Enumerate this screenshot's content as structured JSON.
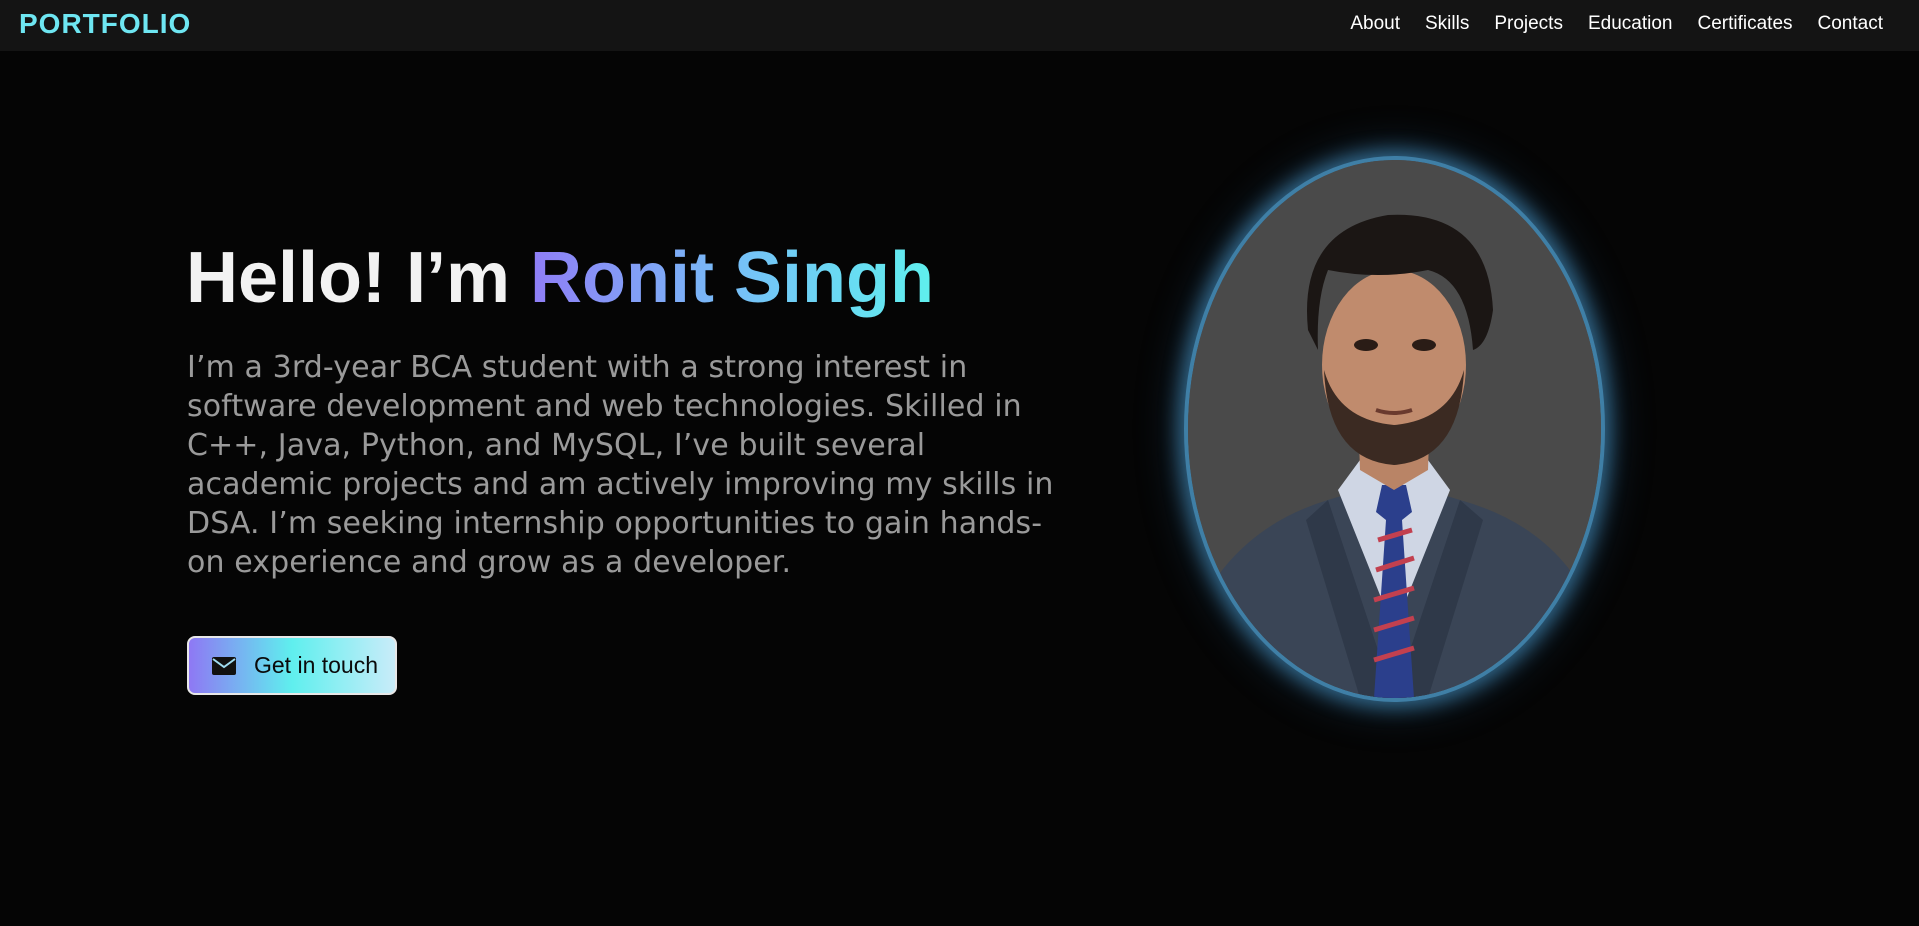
{
  "navbar": {
    "brand": "PORTFOLIO",
    "links": [
      "About",
      "Skills",
      "Projects",
      "Education",
      "Certificates",
      "Contact"
    ]
  },
  "hero": {
    "greeting": "Hello!  I’m ",
    "name": "Ronit Singh",
    "intro": "I’m a 3rd-year BCA student with a strong interest in software development and web technologies. Skilled in C++, Java, Python, and MySQL, I’ve built several academic projects and am actively improving my skills in DSA. I’m seeking internship opportunities to gain hands-on experience and grow as a developer.",
    "cta_label": "Get in touch",
    "cta_icon": "envelope-icon"
  },
  "colors": {
    "accent_purple": "#8f7df6",
    "accent_cyan": "#5ff0ee",
    "background": "#050505",
    "navbar_bg": "#141414",
    "brand": "#6ee6f2",
    "photo_glow": "#3f7fa6"
  }
}
